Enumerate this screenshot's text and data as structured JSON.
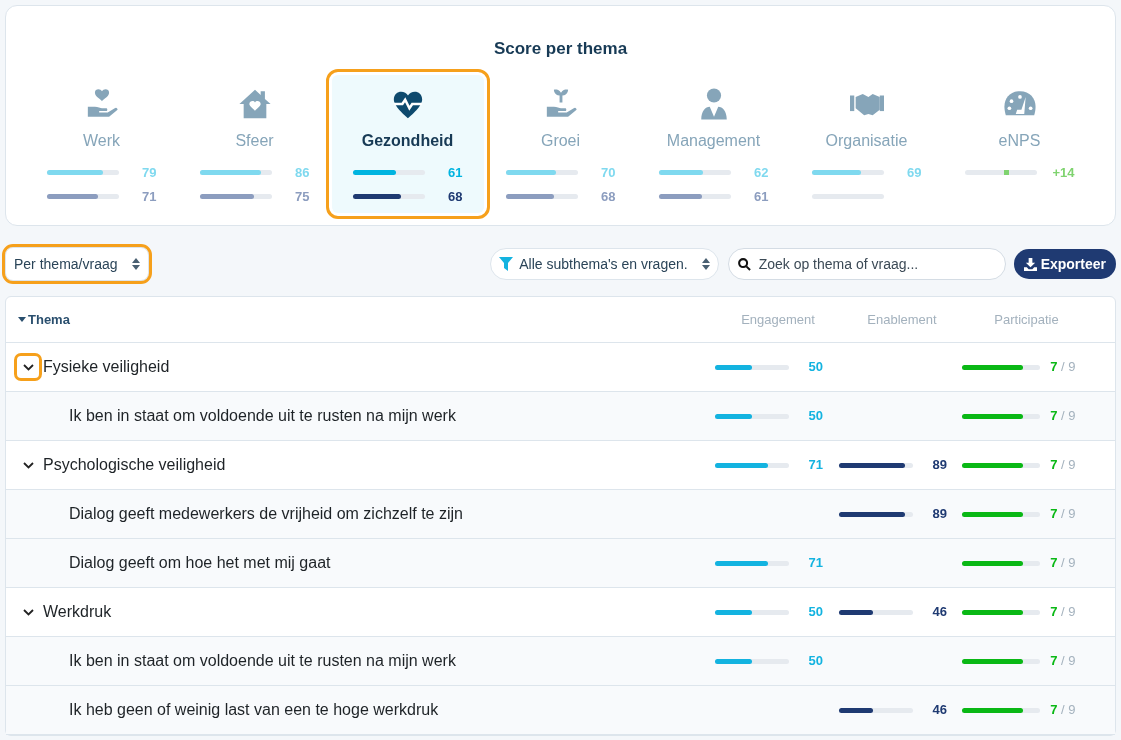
{
  "score_panel": {
    "title": "Score per thema",
    "themes": [
      {
        "kind": "score",
        "name": "Werk",
        "selected": false,
        "engagement": {
          "level": 0.79,
          "value": "79"
        },
        "enablement": {
          "level": 0.71,
          "value": "71"
        }
      },
      {
        "kind": "score",
        "name": "Sfeer",
        "selected": false,
        "engagement": {
          "level": 0.86,
          "value": "86"
        },
        "enablement": {
          "level": 0.75,
          "value": "75"
        }
      },
      {
        "kind": "score",
        "name": "Gezondheid",
        "selected": true,
        "highlighted": true,
        "engagement": {
          "level": 0.61,
          "value": "61"
        },
        "enablement": {
          "level": 0.68,
          "value": "68"
        }
      },
      {
        "kind": "score",
        "name": "Groei",
        "selected": false,
        "engagement": {
          "level": 0.7,
          "value": "70"
        },
        "enablement": {
          "level": 0.68,
          "value": "68"
        }
      },
      {
        "kind": "score",
        "name": "Management",
        "selected": false,
        "engagement": {
          "level": 0.62,
          "value": "62"
        },
        "enablement": {
          "level": 0.61,
          "value": "61"
        }
      },
      {
        "kind": "score",
        "name": "Organisatie",
        "selected": false,
        "engagement": {
          "level": 0.69,
          "value": "69"
        }
      },
      {
        "kind": "enps",
        "name": "eNPS",
        "selected": false,
        "engagement": {
          "level": 0.57,
          "value": "+14"
        }
      }
    ]
  },
  "toolbar": {
    "view_select": {
      "value": "Per thema/vraag",
      "highlighted": true
    },
    "filter_select": {
      "value": "Alle subthema's en vragen."
    },
    "search": {
      "placeholder": "Zoek op thema of vraag..."
    },
    "export_button": "Exporteer"
  },
  "table": {
    "columns": [
      "Thema",
      "Engagement",
      "Enablement",
      "Participatie"
    ],
    "rows": [
      {
        "label": "Fysieke veiligheid",
        "expanded": true,
        "highlighted": true,
        "engagement": {
          "level": 0.5,
          "value": "50"
        },
        "participation": {
          "level": 0.78,
          "count": "7",
          "total": "/ 9"
        },
        "children": [
          {
            "label": "Ik ben in staat om voldoende uit te rusten na mijn werk",
            "engagement": {
              "level": 0.5,
              "value": "50"
            },
            "participation": {
              "level": 0.78,
              "count": "7",
              "total": "/ 9"
            }
          }
        ]
      },
      {
        "label": "Psychologische veiligheid",
        "expanded": true,
        "highlighted": false,
        "engagement": {
          "level": 0.71,
          "value": "71"
        },
        "enablement": {
          "level": 0.89,
          "value": "89"
        },
        "participation": {
          "level": 0.78,
          "count": "7",
          "total": "/ 9"
        },
        "children": [
          {
            "label": "Dialog geeft medewerkers de vrijheid om zichzelf te zijn",
            "enablement": {
              "level": 0.89,
              "value": "89"
            },
            "participation": {
              "level": 0.78,
              "count": "7",
              "total": "/ 9"
            }
          },
          {
            "label": "Dialog geeft om hoe het met mij gaat",
            "engagement": {
              "level": 0.71,
              "value": "71"
            },
            "participation": {
              "level": 0.78,
              "count": "7",
              "total": "/ 9"
            }
          }
        ]
      },
      {
        "label": "Werkdruk",
        "expanded": true,
        "highlighted": false,
        "engagement": {
          "level": 0.5,
          "value": "50"
        },
        "enablement": {
          "level": 0.46,
          "value": "46"
        },
        "participation": {
          "level": 0.78,
          "count": "7",
          "total": "/ 9"
        },
        "children": [
          {
            "label": "Ik ben in staat om voldoende uit te rusten na mijn werk",
            "engagement": {
              "level": 0.5,
              "value": "50"
            },
            "participation": {
              "level": 0.78,
              "count": "7",
              "total": "/ 9"
            }
          },
          {
            "label": "Ik heb geen of weinig last van een te hoge werkdruk",
            "enablement": {
              "level": 0.46,
              "value": "46"
            },
            "participation": {
              "level": 0.78,
              "count": "7",
              "total": "/ 9"
            }
          }
        ]
      }
    ]
  }
}
